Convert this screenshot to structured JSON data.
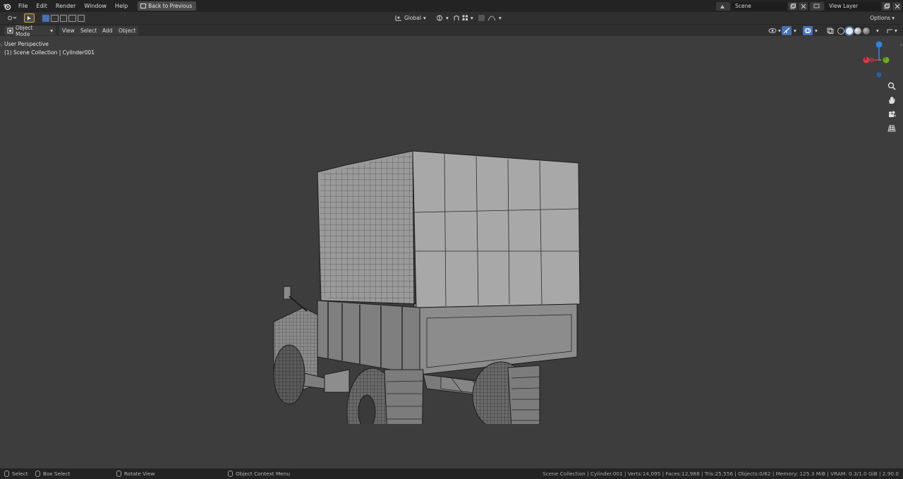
{
  "menu": {
    "items": [
      "File",
      "Edit",
      "Render",
      "Window",
      "Help"
    ],
    "back_label": "Back to Previous"
  },
  "scene": {
    "label": "Scene",
    "view_layer": "View Layer"
  },
  "toolbar": {
    "orientation": "Global",
    "options": "Options"
  },
  "header": {
    "mode": "Object Mode",
    "view": "View",
    "select": "Select",
    "add": "Add",
    "object": "Object"
  },
  "viewport": {
    "perspective": "User Perspective",
    "collection": "(1) Scene Collection | Cylinder001",
    "gizmo": {
      "x": "X",
      "y": "Y"
    }
  },
  "status": {
    "select": "Select",
    "box_select": "Box Select",
    "rotate": "Rotate View",
    "context_menu": "Object Context Menu",
    "stats": "Scene Collection | Cylinder.001 | Verts:14,095 | Faces:12,988 | Tris:25,556 | Objects:0/62 | Memory: 125.3 MiB | VRAM: 0.3/1.0 GiB | 2.90.0"
  },
  "colors": {
    "viewport_bg": "#3d3d3d",
    "header_bg": "#2f2f2f",
    "topbar_bg": "#232323",
    "accent_blue": "#4772b3",
    "axis_x": "#e0394b",
    "axis_y": "#6bb01f",
    "axis_z": "#2f82e6"
  },
  "icons": [
    "blender-logo",
    "back-icon",
    "select-tool-icon",
    "transform-icon",
    "snap-icon",
    "proportional-icon",
    "overlay-icon",
    "shading-solid-icon",
    "zoom-icon",
    "hand-icon",
    "camera-icon",
    "grid-icon"
  ]
}
